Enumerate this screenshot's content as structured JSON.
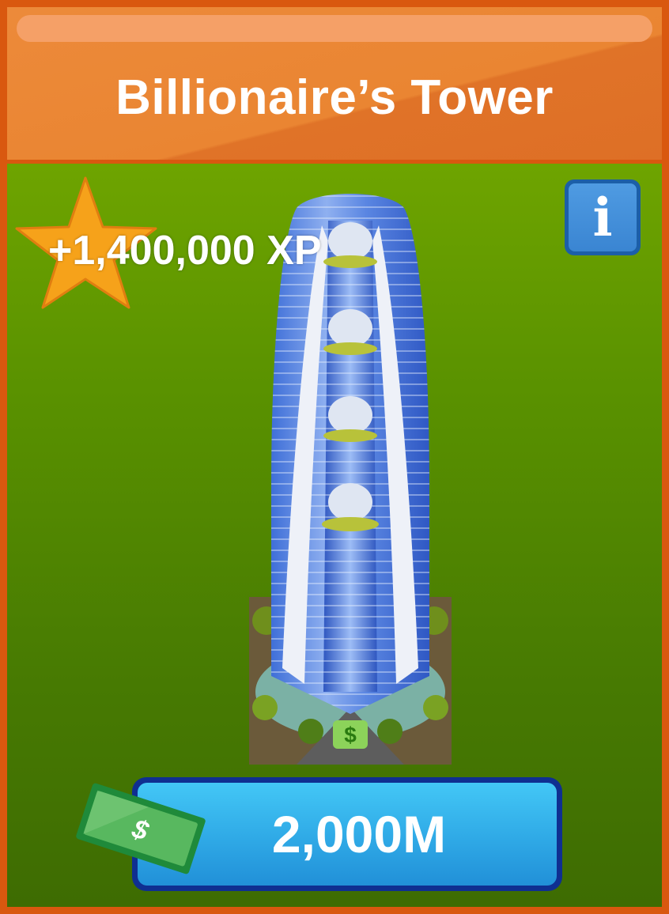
{
  "header": {
    "title": "Billionaire’s Tower"
  },
  "reward": {
    "xp_text": "+1,400,000 XP",
    "icon": "star-icon"
  },
  "info": {
    "label": "i",
    "icon": "info-icon"
  },
  "item": {
    "image": "billionaires-tower-building"
  },
  "purchase": {
    "price": "2,000M",
    "currency_icon": "cash-icon",
    "currency_symbol": "$"
  },
  "colors": {
    "frame": "#d9580f",
    "header": "#ea8532",
    "panel_top": "#6ea400",
    "panel_bottom": "#3e6c02",
    "star": "#f6a21a",
    "button": "#2fa9e6",
    "button_border": "#0f2f91",
    "info_button": "#3a85d2"
  }
}
